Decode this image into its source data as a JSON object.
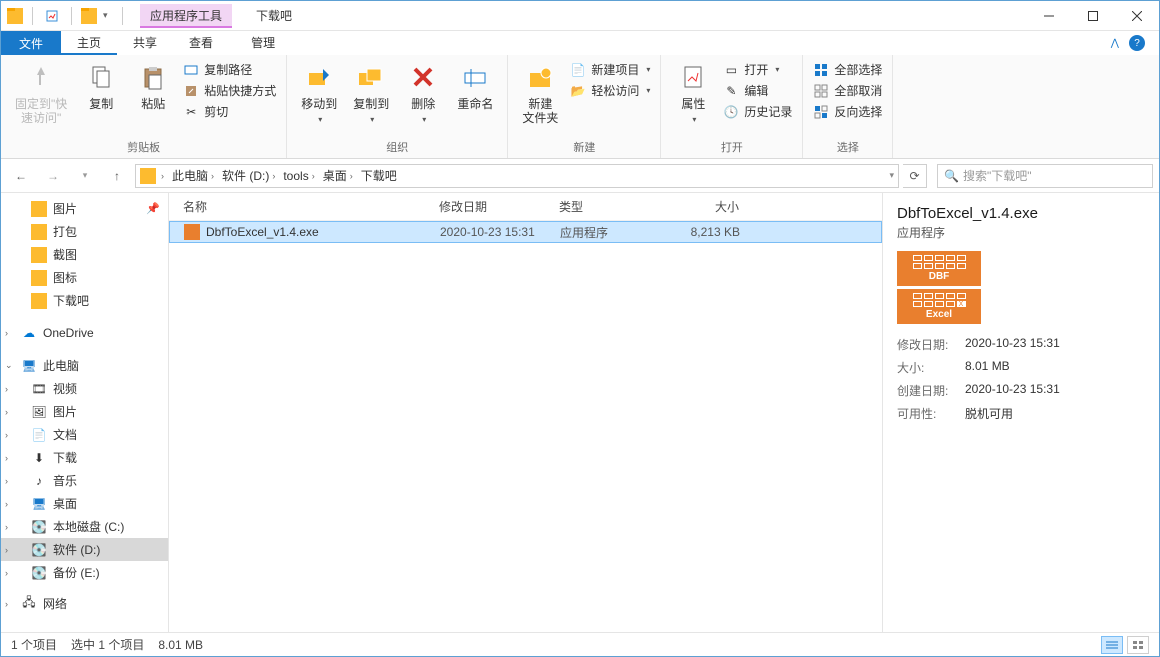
{
  "title_tab": "应用程序工具",
  "window_title": "下载吧",
  "menu": {
    "file": "文件",
    "home": "主页",
    "share": "共享",
    "view": "查看",
    "manage": "管理"
  },
  "ribbon": {
    "pin": "固定到\"快\n速访问\"",
    "copy": "复制",
    "paste": "粘贴",
    "copypath": "复制路径",
    "pasteshortcut": "粘贴快捷方式",
    "cut": "剪切",
    "g1": "剪贴板",
    "moveto": "移动到",
    "copyto": "复制到",
    "delete": "删除",
    "rename": "重命名",
    "g2": "组织",
    "newfolder": "新建\n文件夹",
    "newitem": "新建项目",
    "easyaccess": "轻松访问",
    "g3": "新建",
    "properties": "属性",
    "open": "打开",
    "edit": "编辑",
    "history": "历史记录",
    "g4": "打开",
    "selectall": "全部选择",
    "selectnone": "全部取消",
    "invert": "反向选择",
    "g5": "选择"
  },
  "breadcrumb": [
    "此电脑",
    "软件 (D:)",
    "tools",
    "桌面",
    "下载吧"
  ],
  "search_placeholder": "搜索\"下载吧\"",
  "nav": {
    "pictures": "图片",
    "pack": "打包",
    "screenshot": "截图",
    "icons": "图标",
    "download": "下载吧",
    "onedrive": "OneDrive",
    "thispc": "此电脑",
    "video": "视频",
    "pictures2": "图片",
    "docs": "文档",
    "downloads": "下载",
    "music": "音乐",
    "desktop": "桌面",
    "diskc": "本地磁盘 (C:)",
    "diskd": "软件 (D:)",
    "diske": "备份 (E:)",
    "network": "网络"
  },
  "columns": {
    "name": "名称",
    "date": "修改日期",
    "type": "类型",
    "size": "大小"
  },
  "file": {
    "name": "DbfToExcel_v1.4.exe",
    "date": "2020-10-23 15:31",
    "type": "应用程序",
    "size": "8,213 KB"
  },
  "details": {
    "title": "DbfToExcel_v1.4.exe",
    "sub": "应用程序",
    "dbf": "DBF",
    "excel": "Excel",
    "k_mod": "修改日期:",
    "v_mod": "2020-10-23 15:31",
    "k_size": "大小:",
    "v_size": "8.01 MB",
    "k_created": "创建日期:",
    "v_created": "2020-10-23 15:31",
    "k_avail": "可用性:",
    "v_avail": "脱机可用"
  },
  "status": {
    "count": "1 个项目",
    "selected": "选中 1 个项目",
    "size": "8.01 MB"
  }
}
